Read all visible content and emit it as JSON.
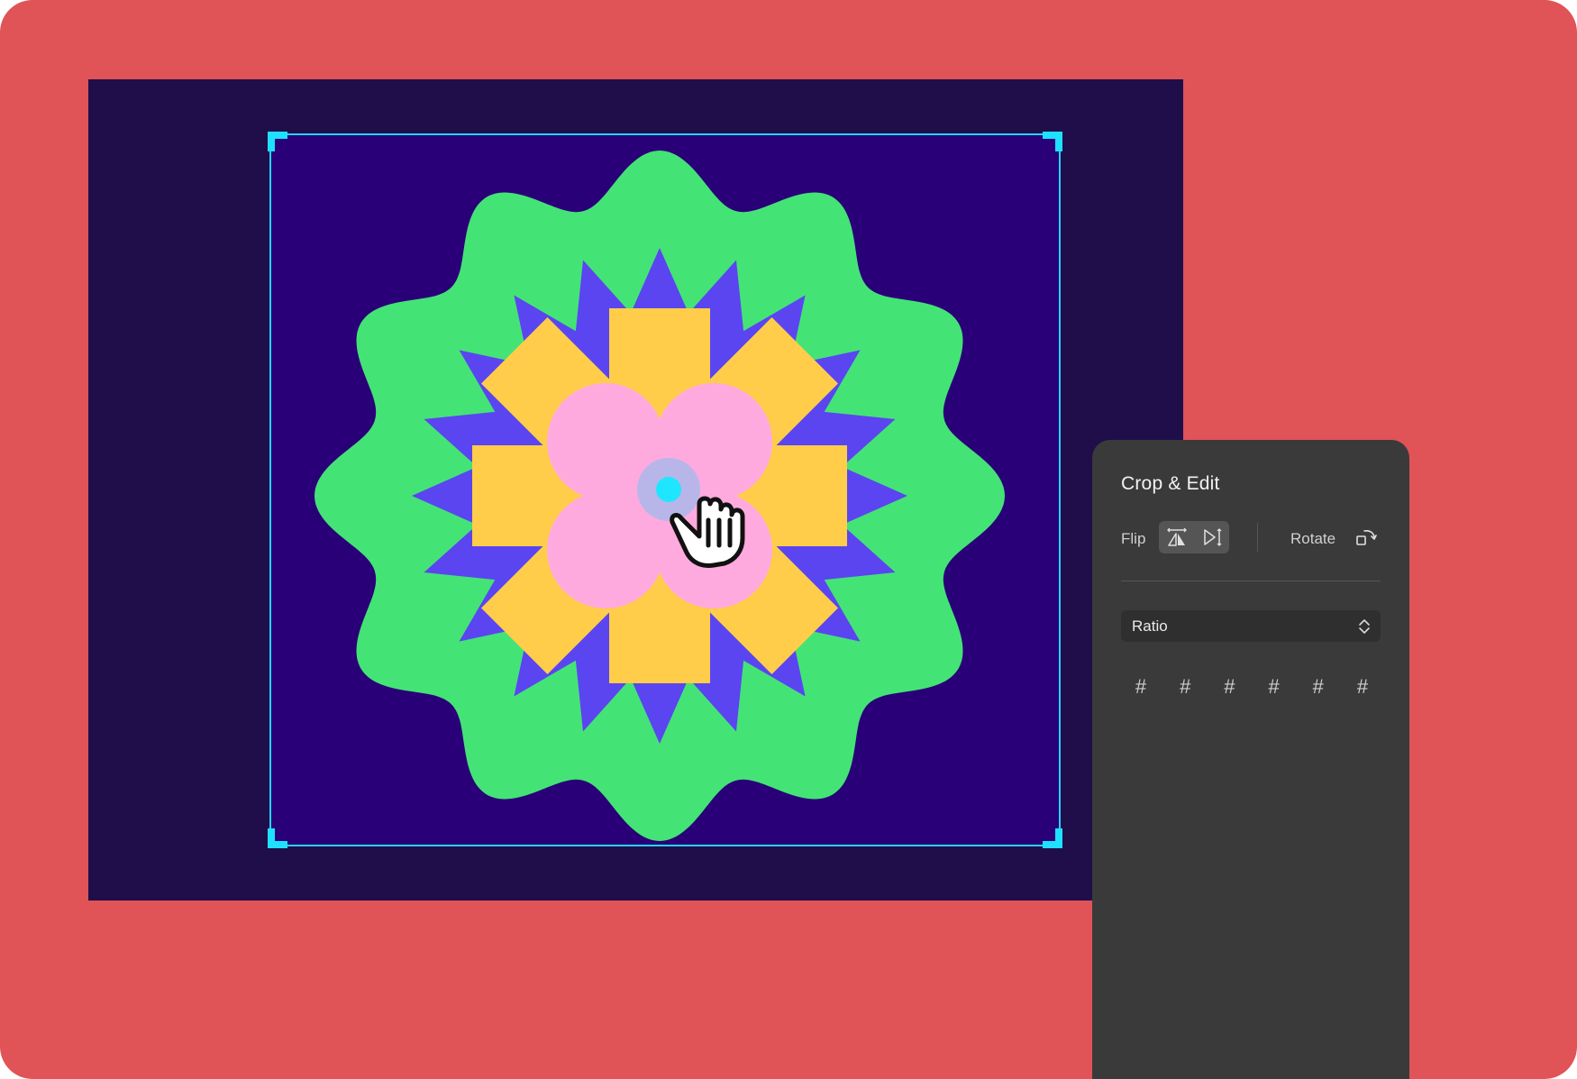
{
  "canvas": {
    "background": "#200e4a",
    "crop_area_color": "#2a0079",
    "crop_border_color": "#22d5f4",
    "artwork_colors": {
      "outer_scallop": "#44e376",
      "star": "#5a45f1",
      "cross": "#ffcd4a",
      "clover": "#ffaadf"
    }
  },
  "cursor": {
    "icon": "grab-hand-icon"
  },
  "panel": {
    "title": "Crop & Edit",
    "flip_label": "Flip",
    "flip_horizontal_icon": "flip-horizontal-icon",
    "flip_vertical_icon": "flip-vertical-icon",
    "rotate_label": "Rotate",
    "rotate_icon": "rotate-icon",
    "ratio": {
      "label": "Ratio",
      "icon": "chevron-up-down-icon"
    },
    "ratio_options": [
      "#",
      "#",
      "#",
      "#",
      "#",
      "#"
    ]
  }
}
